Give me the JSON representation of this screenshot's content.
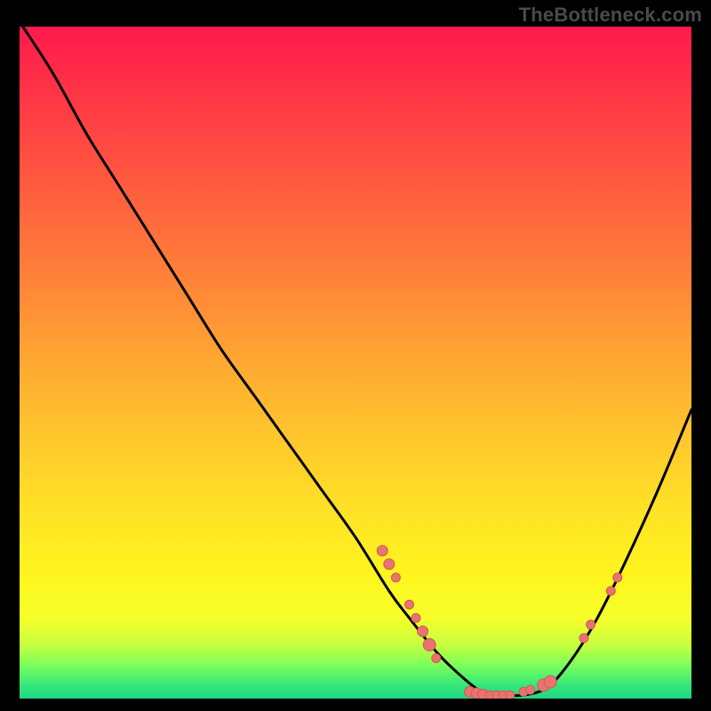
{
  "watermark": "TheBottleneck.com",
  "colors": {
    "background": "#000000",
    "curve": "#000000",
    "marker_fill": "#e9746f",
    "marker_stroke": "#d05a55"
  },
  "chart_data": {
    "type": "line",
    "title": "",
    "xlabel": "",
    "ylabel": "",
    "xlim": [
      0,
      100
    ],
    "ylim": [
      0,
      100
    ],
    "series": [
      {
        "name": "curve",
        "x": [
          0.5,
          5,
          10,
          15,
          20,
          25,
          30,
          35,
          40,
          45,
          50,
          55,
          58,
          62,
          65,
          68,
          70,
          72,
          75,
          78,
          80,
          83,
          86,
          90,
          95,
          100
        ],
        "y": [
          100,
          93,
          84,
          76,
          68,
          60,
          52,
          45,
          38,
          31,
          24,
          16,
          12,
          7,
          4,
          1.5,
          0.7,
          0.5,
          0.5,
          1.3,
          3,
          7,
          12,
          20,
          31,
          43
        ]
      }
    ],
    "markers": [
      {
        "x": 54,
        "y": 22,
        "r": 6
      },
      {
        "x": 55,
        "y": 20,
        "r": 6
      },
      {
        "x": 56,
        "y": 18,
        "r": 5
      },
      {
        "x": 58,
        "y": 14,
        "r": 5
      },
      {
        "x": 59,
        "y": 12,
        "r": 5
      },
      {
        "x": 60,
        "y": 10,
        "r": 6
      },
      {
        "x": 61,
        "y": 8,
        "r": 7
      },
      {
        "x": 62,
        "y": 6,
        "r": 5
      },
      {
        "x": 67,
        "y": 1,
        "r": 6
      },
      {
        "x": 68,
        "y": 0.8,
        "r": 6
      },
      {
        "x": 69,
        "y": 0.6,
        "r": 6
      },
      {
        "x": 70,
        "y": 0.5,
        "r": 5
      },
      {
        "x": 71,
        "y": 0.5,
        "r": 5
      },
      {
        "x": 72,
        "y": 0.5,
        "r": 5
      },
      {
        "x": 73,
        "y": 0.5,
        "r": 5
      },
      {
        "x": 75,
        "y": 1,
        "r": 5
      },
      {
        "x": 76,
        "y": 1.3,
        "r": 5
      },
      {
        "x": 78,
        "y": 2,
        "r": 7
      },
      {
        "x": 79,
        "y": 2.5,
        "r": 7
      },
      {
        "x": 84,
        "y": 9,
        "r": 5
      },
      {
        "x": 85,
        "y": 11,
        "r": 5
      },
      {
        "x": 88,
        "y": 16,
        "r": 5
      },
      {
        "x": 89,
        "y": 18,
        "r": 5
      }
    ]
  }
}
